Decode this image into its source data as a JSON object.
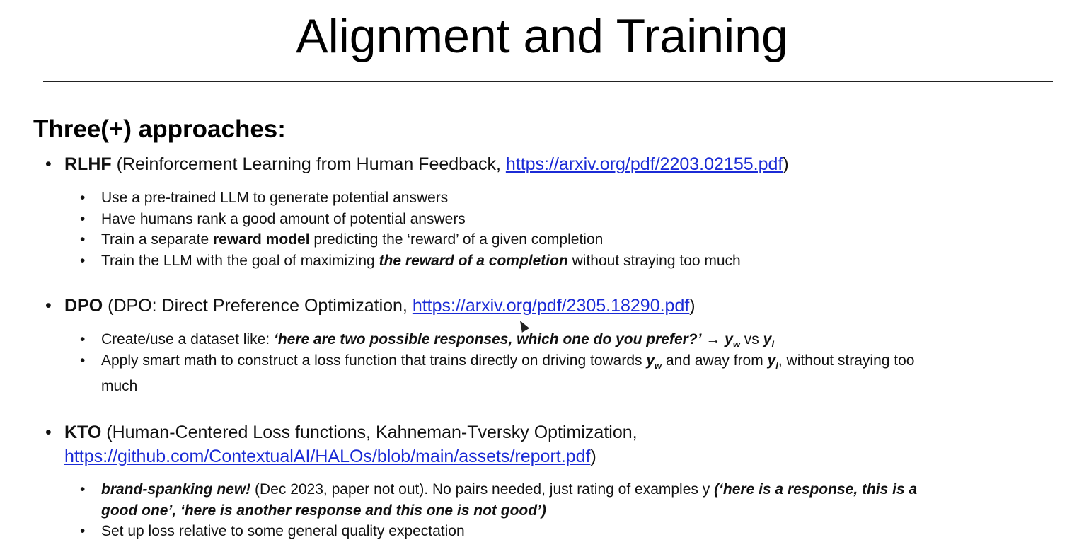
{
  "title": "Alignment and Training",
  "heading": "Three(+) approaches:",
  "rlhf": {
    "name": "RLHF",
    "desc": " (Reinforcement Learning from Human Feedback, ",
    "link": "https://arxiv.org/pdf/2203.02155.pdf",
    "close": ")",
    "b1": "Use a pre-trained LLM to generate potential answers",
    "b2": "Have humans rank a good amount of potential answers",
    "b3_pre": "Train a separate ",
    "b3_bold": "reward model",
    "b3_post": " predicting the ‘reward’ of a given completion",
    "b4_pre": "Train the LLM with the goal of maximizing ",
    "b4_bi": "the reward of a completion",
    "b4_post": " without straying too much"
  },
  "dpo": {
    "name": "DPO",
    "desc": " (DPO: Direct Preference Optimization, ",
    "link": "https://arxiv.org/pdf/2305.18290.pdf",
    "close": ")",
    "b1_pre": "Create/use a dataset like: ",
    "b1_bi": "‘here are two possible responses, which one do you prefer?’",
    "b1_arrow": " → ",
    "b1_yw": "y",
    "b1_w": "w",
    "b1_vs": " vs ",
    "b1_yl": "y",
    "b1_l": "l",
    "b2_pre": "Apply smart math to construct a loss function that trains directly on driving towards ",
    "b2_yw": "y",
    "b2_w": "w",
    "b2_mid": " and away from ",
    "b2_yl": "y",
    "b2_l": "l",
    "b2_post": ", without straying too",
    "b2_line2": "much"
  },
  "kto": {
    "name": "KTO",
    "desc": " (Human-Centered Loss functions, Kahneman-Tversky Optimization,",
    "link": "https://github.com/ContextualAI/HALOs/blob/main/assets/report.pdf",
    "close": ")",
    "b1_bi": "brand-spanking new!",
    "b1_mid": " (Dec 2023, paper not out). No pairs needed, just rating of examples y ",
    "b1_q1": "(‘here is a response, this is a",
    "b1_q2": "good one’, ‘here is another response and this one is not good’)",
    "b2": "Set up loss relative to some general quality expectation"
  },
  "bullet1": "•",
  "bullet2": "•"
}
